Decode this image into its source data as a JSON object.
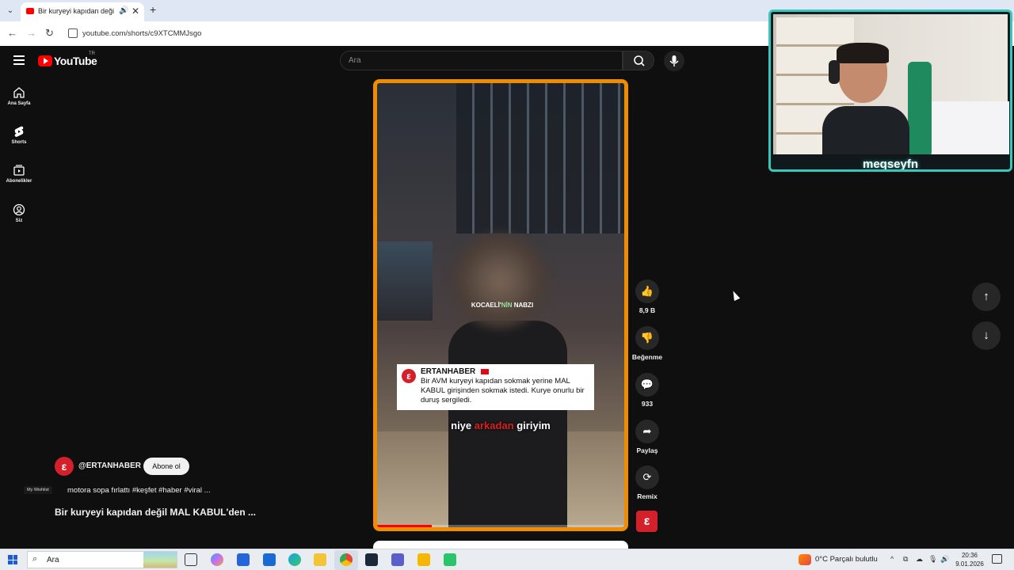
{
  "browser": {
    "tab_title": "Bir kuryeyi kapıdan değil M",
    "url": "youtube.com/shorts/c9XTCMMJsgo"
  },
  "youtube": {
    "logo_text": "YouTube",
    "region": "TR",
    "search_placeholder": "Ara",
    "sidebar": [
      {
        "label": "Ana Sayfa",
        "icon": "home-icon"
      },
      {
        "label": "Shorts",
        "icon": "shorts-icon"
      },
      {
        "label": "Abonelikler",
        "icon": "subscriptions-icon"
      },
      {
        "label": "Siz",
        "icon": "account-icon"
      }
    ]
  },
  "video": {
    "arc_text_main": "KOCAELİ'",
    "arc_text_hl": "NİN",
    "arc_text_end": " NABZI",
    "news_card": {
      "source": "ERTANHABER",
      "text": "Bir AVM kuryeyi kapıdan sokmak yerine MAL KABUL girişinden sokmak istedi. Kurye onurlu bir duruş sergiledi."
    },
    "caption_pre": "niye ",
    "caption_red": "arkadan",
    "caption_post": " giriyim",
    "progress": 0.22
  },
  "actions": {
    "like_count": "8,9 B",
    "dislike_label": "Beğenme",
    "comment_count": "933",
    "share_label": "Paylaş",
    "remix_label": "Remix"
  },
  "meta": {
    "channel": "@ERTANHABER",
    "subscribe_label": "Abone ol",
    "overlay_tag": "My Wishlist",
    "description": "motora sopa fırlattı #keşfet #haber #viral ...",
    "title": "Bir kuryeyi kapıdan değil MAL KABUL'den ..."
  },
  "webcam": {
    "name": "meqseyfn"
  },
  "taskbar": {
    "search_text": "Ara",
    "weather": "0°C  Parçalı bulutlu",
    "time": "20:36",
    "date": "9.01.2026"
  },
  "colors": {
    "accent": "#f08c00",
    "brand": "#ff0000",
    "channel": "#d4202a",
    "webcam_border": "#39c7bb"
  }
}
